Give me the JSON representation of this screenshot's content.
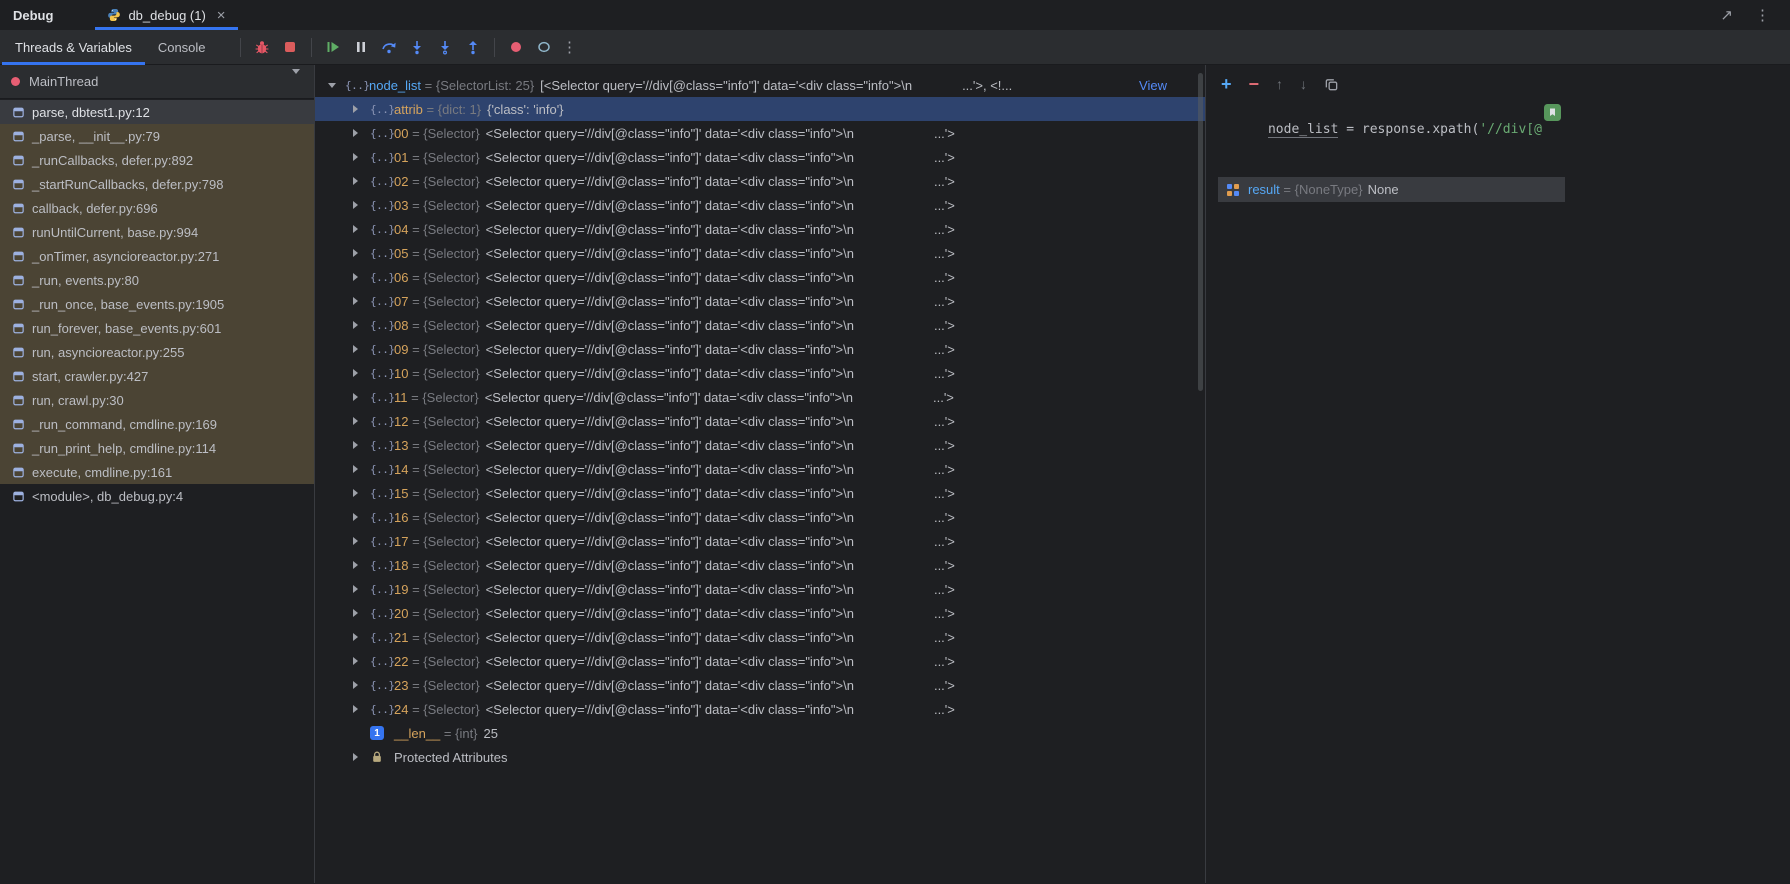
{
  "colors": {
    "accent_blue": "#3574f0",
    "selection_blue": "#2e436e",
    "selection_gray": "#393b40",
    "library_frame_bg": "#4b4434",
    "toolbar_bg": "#2b2d30",
    "background": "#1e1f22",
    "name_amber": "#d5a35c",
    "name_blue": "#56a8f5",
    "type_gray": "#787a80",
    "string_green": "#6aab73",
    "link_blue": "#548af7",
    "stop_red": "#db5c5c",
    "resume_green": "#5fad65"
  },
  "icons": {
    "close": "×",
    "more": "⋮",
    "open_in_new": "↗",
    "add": "+",
    "remove": "−",
    "up": "↑",
    "down": "↓",
    "object_braces": "{..}",
    "one_badge": "1"
  },
  "titlebar": {
    "title": "Debug",
    "tab_label": "db_debug (1)"
  },
  "debug_toolbar": {
    "tabs": [
      "Threads & Variables",
      "Console"
    ]
  },
  "frames": {
    "thread_name": "MainThread",
    "items": [
      {
        "label": "parse, dbtest1.py:12",
        "state": "selected"
      },
      {
        "label": "_parse, __init__.py:79",
        "state": "library"
      },
      {
        "label": "_runCallbacks, defer.py:892",
        "state": "library"
      },
      {
        "label": "_startRunCallbacks, defer.py:798",
        "state": "library"
      },
      {
        "label": "callback, defer.py:696",
        "state": "library"
      },
      {
        "label": "runUntilCurrent, base.py:994",
        "state": "library"
      },
      {
        "label": "_onTimer, asyncioreactor.py:271",
        "state": "library"
      },
      {
        "label": "_run, events.py:80",
        "state": "library"
      },
      {
        "label": "_run_once, base_events.py:1905",
        "state": "library"
      },
      {
        "label": "run_forever, base_events.py:601",
        "state": "library"
      },
      {
        "label": "run, asyncioreactor.py:255",
        "state": "library"
      },
      {
        "label": "start, crawler.py:427",
        "state": "library"
      },
      {
        "label": "run, crawl.py:30",
        "state": "library"
      },
      {
        "label": "_run_command, cmdline.py:169",
        "state": "library"
      },
      {
        "label": "_run_print_help, cmdline.py:114",
        "state": "library"
      },
      {
        "label": "execute, cmdline.py:161",
        "state": "library"
      },
      {
        "label": "<module>, db_debug.py:4",
        "state": "normal"
      }
    ]
  },
  "variables": {
    "eq": " = ",
    "root": {
      "name": "node_list",
      "type": "{SelectorList: 25}",
      "value": "[<Selector query='//div[@class=\"info\"]' data='<div class=\"info\">\\n",
      "tail": "...'>, <!...",
      "view": "View"
    },
    "attrib": {
      "name": "attrib",
      "type": "{dict: 1}",
      "value": "{'class': 'info'}"
    },
    "selector_rows": {
      "indices": [
        "00",
        "01",
        "02",
        "03",
        "04",
        "05",
        "06",
        "07",
        "08",
        "09",
        "10",
        "11",
        "12",
        "13",
        "14",
        "15",
        "16",
        "17",
        "18",
        "19",
        "20",
        "21",
        "22",
        "23",
        "24"
      ],
      "type": "{Selector}",
      "value": "<Selector query='//div[@class=\"info\"]' data='<div class=\"info\">\\n",
      "tail": "...'>"
    },
    "len": {
      "name": "__len__",
      "type": "{int}",
      "value": "25"
    },
    "protected_label": "Protected Attributes"
  },
  "watches": {
    "expression": {
      "name": "node_list",
      "eq": " = ",
      "code": "response.xpath(",
      "string": "'//div[@"
    },
    "result": {
      "name": "result",
      "type": "{NoneType}",
      "value": "None"
    }
  }
}
